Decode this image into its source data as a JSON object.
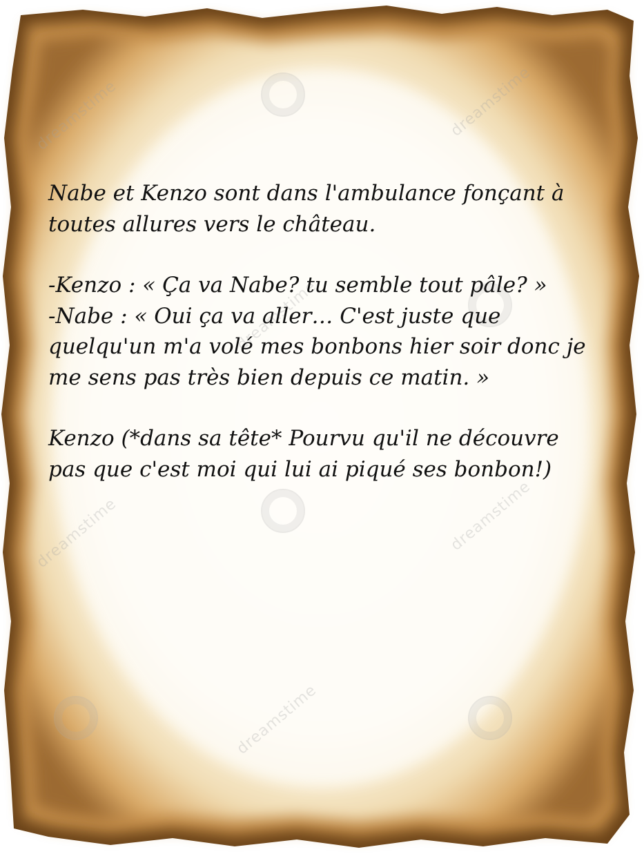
{
  "story": {
    "paragraph_1": "Nabe et Kenzo sont dans l'ambulance fonçant à toutes allures vers le château.",
    "dialogue_1": "-Kenzo : « Ça va Nabe? tu semble tout pâle? »",
    "dialogue_2": "-Nabe : « Oui ça va aller… C'est juste que quelqu'un m'a volé mes bonbons hier soir donc je me sens pas très bien depuis ce matin. »",
    "paragraph_2": "Kenzo (*dans sa tête* Pourvu qu'il ne découvre pas que c'est moi qui lui ai piqué ses bonbon!)"
  },
  "watermark": {
    "text": "dreamstime"
  },
  "colors": {
    "paper": "#fdf8ee",
    "burn_dark": "#5a3a1a",
    "burn_mid": "#b07a3a",
    "text": "#111111"
  }
}
